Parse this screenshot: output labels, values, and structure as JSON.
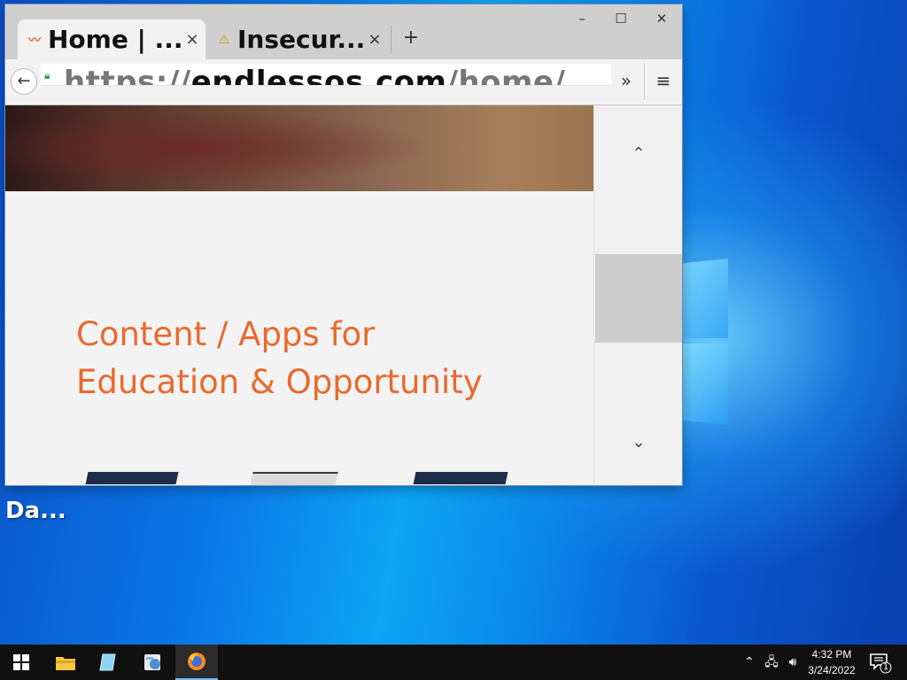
{
  "desktop": {
    "icon_label": "Da..."
  },
  "browser": {
    "tabs": [
      {
        "title": "Home | ...",
        "favicon": "orange-swirl-icon",
        "active": true,
        "close": "×"
      },
      {
        "title": "Insecur...",
        "favicon": "warning-icon",
        "active": false,
        "close": "×"
      }
    ],
    "new_tab": "+",
    "window_controls": {
      "minimize": "–",
      "maximize": "☐",
      "close": "✕"
    },
    "url": {
      "scheme": "https://",
      "host": "endlessos.com",
      "path": "/home/"
    },
    "overflow_label": "»",
    "menu_label": "≡",
    "page": {
      "headline_line1": "Content / Apps for",
      "headline_line2": "Education & Opportunity"
    },
    "scrollbar": {
      "up": "⌃",
      "down": "⌄"
    }
  },
  "taskbar": {
    "time": "4:32 PM",
    "date": "3/24/2022",
    "notification_count": "1"
  },
  "colors": {
    "headline": "#e86a2e",
    "taskbar": "#101010",
    "accent": "#76b9ed"
  }
}
